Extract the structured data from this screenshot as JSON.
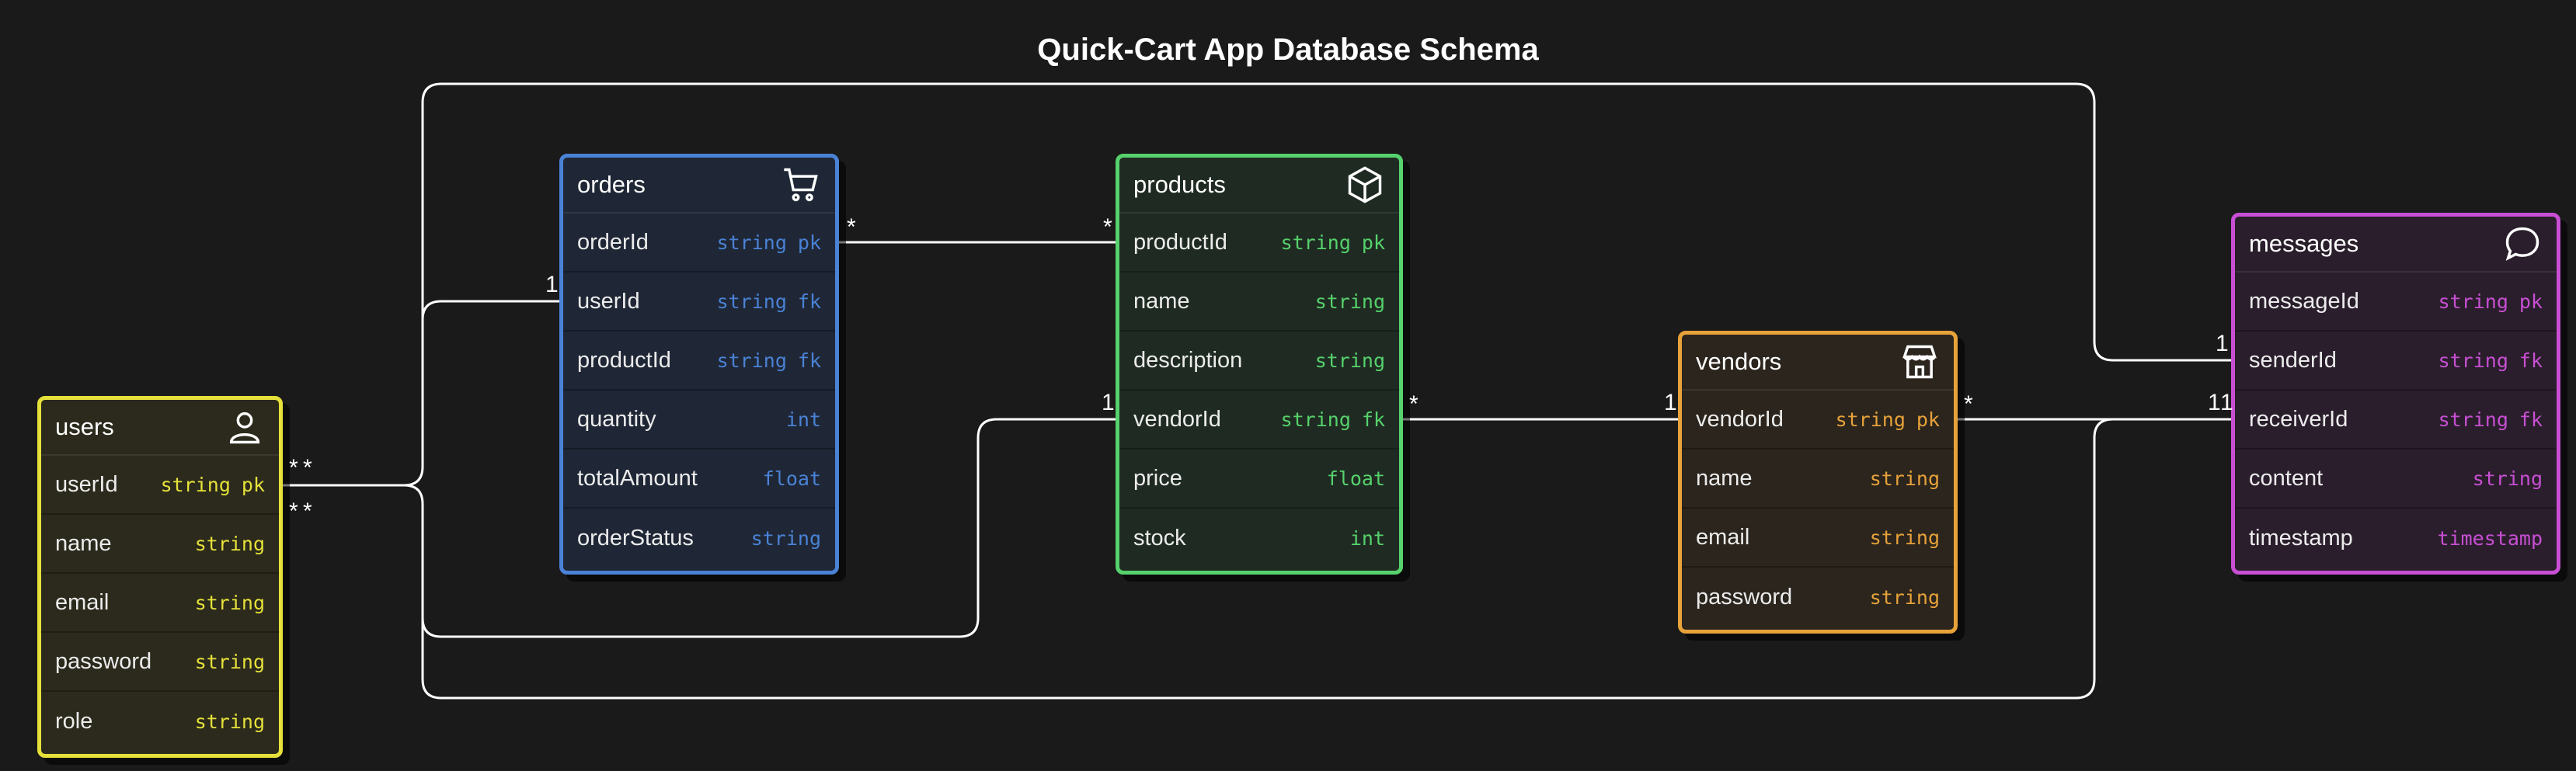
{
  "title": "Quick-Cart App Database Schema",
  "colors": {
    "users": "#e6e13a",
    "orders": "#4a82d6",
    "products": "#56d26c",
    "vendors": "#e8a23a",
    "messages": "#c84fd3",
    "line": "#ffffff",
    "background": "#1a1a1a"
  },
  "entities": {
    "users": {
      "name": "users",
      "icon": "user-icon",
      "fields": [
        {
          "name": "userId",
          "type": "string",
          "key": "pk"
        },
        {
          "name": "name",
          "type": "string",
          "key": ""
        },
        {
          "name": "email",
          "type": "string",
          "key": ""
        },
        {
          "name": "password",
          "type": "string",
          "key": ""
        },
        {
          "name": "role",
          "type": "string",
          "key": ""
        }
      ]
    },
    "orders": {
      "name": "orders",
      "icon": "cart-icon",
      "fields": [
        {
          "name": "orderId",
          "type": "string",
          "key": "pk"
        },
        {
          "name": "userId",
          "type": "string",
          "key": "fk"
        },
        {
          "name": "productId",
          "type": "string",
          "key": "fk"
        },
        {
          "name": "quantity",
          "type": "int",
          "key": ""
        },
        {
          "name": "totalAmount",
          "type": "float",
          "key": ""
        },
        {
          "name": "orderStatus",
          "type": "string",
          "key": ""
        }
      ]
    },
    "products": {
      "name": "products",
      "icon": "box-icon",
      "fields": [
        {
          "name": "productId",
          "type": "string",
          "key": "pk"
        },
        {
          "name": "name",
          "type": "string",
          "key": ""
        },
        {
          "name": "description",
          "type": "string",
          "key": ""
        },
        {
          "name": "vendorId",
          "type": "string",
          "key": "fk"
        },
        {
          "name": "price",
          "type": "float",
          "key": ""
        },
        {
          "name": "stock",
          "type": "int",
          "key": ""
        }
      ]
    },
    "vendors": {
      "name": "vendors",
      "icon": "store-icon",
      "fields": [
        {
          "name": "vendorId",
          "type": "string",
          "key": "pk"
        },
        {
          "name": "name",
          "type": "string",
          "key": ""
        },
        {
          "name": "email",
          "type": "string",
          "key": ""
        },
        {
          "name": "password",
          "type": "string",
          "key": ""
        }
      ]
    },
    "messages": {
      "name": "messages",
      "icon": "chat-icon",
      "fields": [
        {
          "name": "messageId",
          "type": "string",
          "key": "pk"
        },
        {
          "name": "senderId",
          "type": "string",
          "key": "fk"
        },
        {
          "name": "receiverId",
          "type": "string",
          "key": "fk"
        },
        {
          "name": "content",
          "type": "string",
          "key": ""
        },
        {
          "name": "timestamp",
          "type": "timestamp",
          "key": ""
        }
      ]
    }
  },
  "cardinalities": {
    "users_orders": "*",
    "users_messages": "*",
    "orders_userId": "1",
    "orders_productId": "*",
    "products_productId": "*",
    "products_vendorId_users": "1",
    "products_vendorId": "*",
    "vendors_vendorId_left": "1",
    "vendors_vendorId_right": "*",
    "messages_senderId": "1",
    "messages_receiverId_a": "1",
    "messages_receiverId_b": "1"
  }
}
